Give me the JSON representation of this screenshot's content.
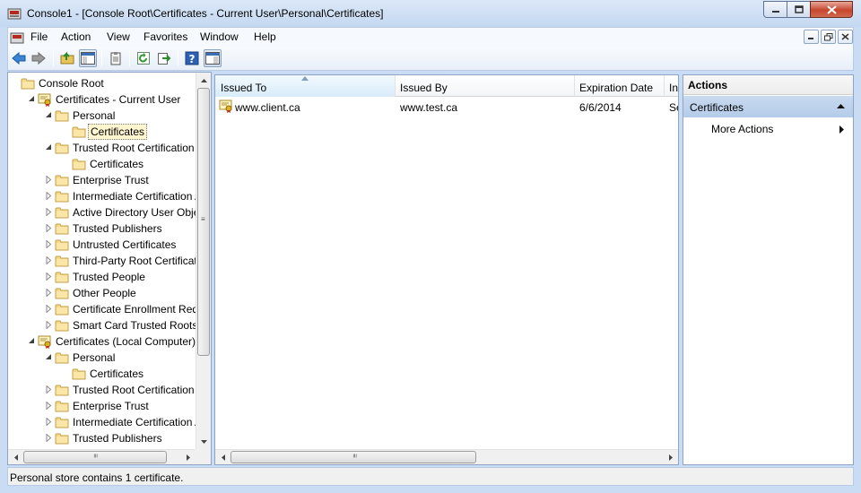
{
  "window": {
    "title": "Console1 - [Console Root\\Certificates - Current User\\Personal\\Certificates]"
  },
  "menu": {
    "items": [
      "File",
      "Action",
      "View",
      "Favorites",
      "Window",
      "Help"
    ]
  },
  "tree": {
    "items": [
      {
        "label": "Console Root",
        "level": 0,
        "icon": "console-root-icon",
        "expander": "none"
      },
      {
        "label": "Certificates - Current User",
        "level": 1,
        "icon": "certificates-snapin-icon",
        "expander": "expanded"
      },
      {
        "label": "Personal",
        "level": 2,
        "icon": "folder-icon",
        "expander": "expanded"
      },
      {
        "label": "Certificates",
        "level": 3,
        "icon": "folder-icon",
        "expander": "none",
        "selected": true
      },
      {
        "label": "Trusted Root Certification Authorities",
        "level": 2,
        "icon": "folder-icon",
        "expander": "expanded"
      },
      {
        "label": "Certificates",
        "level": 3,
        "icon": "folder-icon",
        "expander": "none"
      },
      {
        "label": "Enterprise Trust",
        "level": 2,
        "icon": "folder-icon",
        "expander": "collapsed"
      },
      {
        "label": "Intermediate Certification Authorities",
        "level": 2,
        "icon": "folder-icon",
        "expander": "collapsed"
      },
      {
        "label": "Active Directory User Object",
        "level": 2,
        "icon": "folder-icon",
        "expander": "collapsed"
      },
      {
        "label": "Trusted Publishers",
        "level": 2,
        "icon": "folder-icon",
        "expander": "collapsed"
      },
      {
        "label": "Untrusted Certificates",
        "level": 2,
        "icon": "folder-icon",
        "expander": "collapsed"
      },
      {
        "label": "Third-Party Root Certification Authorities",
        "level": 2,
        "icon": "folder-icon",
        "expander": "collapsed"
      },
      {
        "label": "Trusted People",
        "level": 2,
        "icon": "folder-icon",
        "expander": "collapsed"
      },
      {
        "label": "Other People",
        "level": 2,
        "icon": "folder-icon",
        "expander": "collapsed"
      },
      {
        "label": "Certificate Enrollment Requests",
        "level": 2,
        "icon": "folder-icon",
        "expander": "collapsed"
      },
      {
        "label": "Smart Card Trusted Roots",
        "level": 2,
        "icon": "folder-icon",
        "expander": "collapsed"
      },
      {
        "label": "Certificates (Local Computer)",
        "level": 1,
        "icon": "certificates-snapin-icon",
        "expander": "expanded"
      },
      {
        "label": "Personal",
        "level": 2,
        "icon": "folder-icon",
        "expander": "expanded"
      },
      {
        "label": "Certificates",
        "level": 3,
        "icon": "folder-icon",
        "expander": "none"
      },
      {
        "label": "Trusted Root Certification Authorities",
        "level": 2,
        "icon": "folder-icon",
        "expander": "collapsed"
      },
      {
        "label": "Enterprise Trust",
        "level": 2,
        "icon": "folder-icon",
        "expander": "collapsed"
      },
      {
        "label": "Intermediate Certification Authorities",
        "level": 2,
        "icon": "folder-icon",
        "expander": "collapsed"
      },
      {
        "label": "Trusted Publishers",
        "level": 2,
        "icon": "folder-icon",
        "expander": "collapsed"
      }
    ]
  },
  "list": {
    "columns": [
      "Issued To",
      "Issued By",
      "Expiration Date",
      "Intended Purposes"
    ],
    "sorted_column": "Issued To",
    "rows": [
      {
        "issued_to": "www.client.ca",
        "issued_by": "www.test.ca",
        "expiration": "6/6/2014",
        "purposes": "Server Authentication"
      }
    ]
  },
  "actions": {
    "header": "Actions",
    "section": "Certificates",
    "items": [
      "More Actions"
    ]
  },
  "status": {
    "text": "Personal store contains 1 certificate."
  },
  "colors": {
    "frame": "#c9dcf3",
    "selection": "#fff5cf",
    "actions_section": "#b4cbe9"
  }
}
